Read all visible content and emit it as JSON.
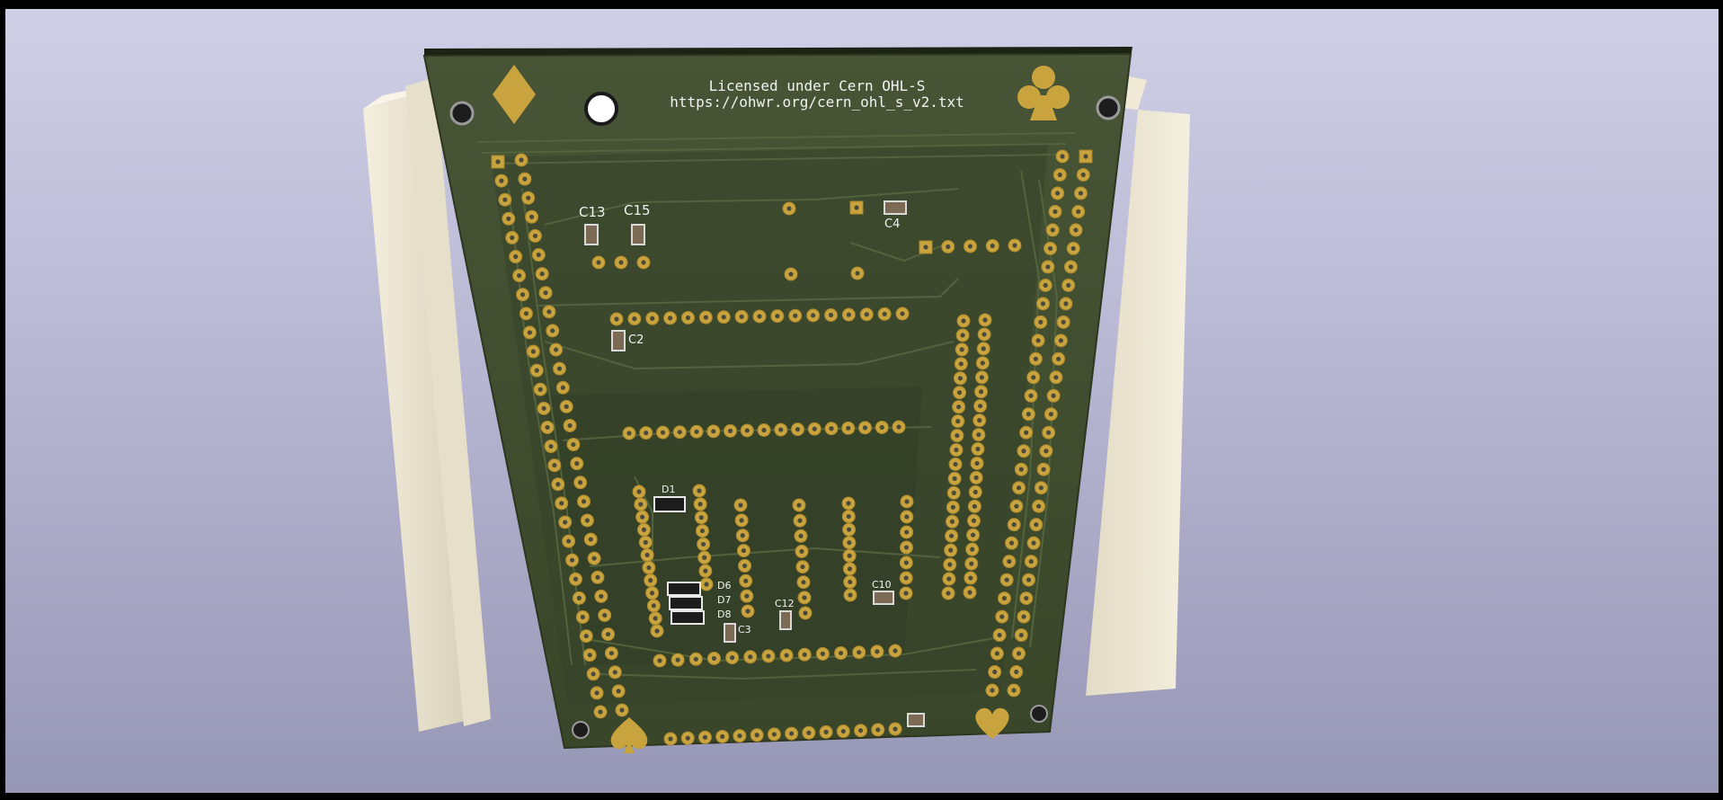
{
  "board": {
    "license_line1": "Licensed under Cern OHL-S",
    "license_line2": "https://ohwr.org/cern_ohl_s_v2.txt"
  },
  "silkscreen_labels": {
    "c13": "C13",
    "c15": "C15",
    "c4": "C4",
    "c2": "C2",
    "d1": "D1",
    "d6": "D6",
    "d7": "D7",
    "d8": "D8",
    "c3": "C3",
    "c12": "C12",
    "c10": "C10"
  },
  "card_symbols": [
    "diamond-icon",
    "club-icon",
    "spade-icon",
    "heart-icon"
  ],
  "colors": {
    "background_top": "#cfcfe6",
    "background_bottom": "#9797b6",
    "pcb_green": "#3e4a2d",
    "copper_gold": "#c9a43e",
    "connector_ivory": "#ece6d2",
    "silkscreen": "#f2f2f2"
  }
}
